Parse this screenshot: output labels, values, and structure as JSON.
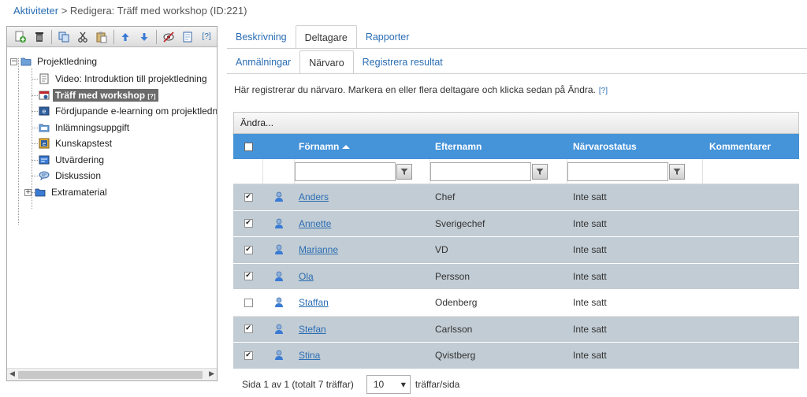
{
  "breadcrumb": {
    "link": "Aktiviteter",
    "separator": ">",
    "current": "Redigera: Träff med workshop (ID:221)"
  },
  "toolbar": {
    "buttons": [
      {
        "icon": "add-icon"
      },
      {
        "icon": "delete-icon"
      },
      {
        "icon": "copy-icon"
      },
      {
        "icon": "cut-icon"
      },
      {
        "icon": "paste-icon"
      },
      {
        "icon": "move-up-icon"
      },
      {
        "icon": "move-down-icon"
      },
      {
        "icon": "hide-icon"
      },
      {
        "icon": "preview-icon"
      },
      {
        "icon": "help-icon",
        "label": "[?]"
      }
    ]
  },
  "tree": {
    "root": {
      "label": "Projektledning",
      "expander": "−",
      "icon": "folder-icon"
    },
    "items": [
      {
        "label": "Video: Introduktion till projektledning",
        "icon": "document-icon"
      },
      {
        "label": "Träff med workshop",
        "badge": "[?]",
        "icon": "meeting-icon",
        "selected": true
      },
      {
        "label": "Fördjupande e-learning om projektledning",
        "icon": "elearning-icon"
      },
      {
        "label": "Inlämningsuppgift",
        "icon": "assignment-icon"
      },
      {
        "label": "Kunskapstest",
        "icon": "test-icon"
      },
      {
        "label": "Utvärdering",
        "icon": "evaluation-icon"
      },
      {
        "label": "Diskussion",
        "icon": "discussion-icon"
      },
      {
        "label": "Extramaterial",
        "icon": "folder-icon",
        "expander": "+"
      }
    ]
  },
  "tabs_main": [
    {
      "label": "Beskrivning",
      "active": false
    },
    {
      "label": "Deltagare",
      "active": true
    },
    {
      "label": "Rapporter",
      "active": false
    }
  ],
  "tabs_sub": [
    {
      "label": "Anmälningar",
      "active": false
    },
    {
      "label": "Närvaro",
      "active": true
    },
    {
      "label": "Registrera resultat",
      "active": false
    }
  ],
  "info": {
    "text": "Här registrerar du närvaro. Markera en eller flera deltagare och klicka sedan på Ändra.",
    "help": "[?]"
  },
  "grid": {
    "toolbar_label": "Ändra...",
    "columns": {
      "first_name": "Förnamn",
      "last_name": "Efternamn",
      "status": "Närvarostatus",
      "comment": "Kommentarer"
    },
    "rows": [
      {
        "checked": true,
        "first": "Anders",
        "last": "Chef",
        "status": "Inte satt",
        "comment": ""
      },
      {
        "checked": true,
        "first": "Annette",
        "last": "Sverigechef",
        "status": "Inte satt",
        "comment": ""
      },
      {
        "checked": true,
        "first": "Marianne",
        "last": "VD",
        "status": "Inte satt",
        "comment": ""
      },
      {
        "checked": true,
        "first": "Ola",
        "last": "Persson",
        "status": "Inte satt",
        "comment": ""
      },
      {
        "checked": false,
        "first": "Staffan",
        "last": "Odenberg",
        "status": "Inte satt",
        "comment": ""
      },
      {
        "checked": true,
        "first": "Stefan",
        "last": "Carlsson",
        "status": "Inte satt",
        "comment": ""
      },
      {
        "checked": true,
        "first": "Stina",
        "last": "Qvistberg",
        "status": "Inte satt",
        "comment": ""
      }
    ]
  },
  "pager": {
    "summary": "Sida 1 av 1 (totalt 7 träffar)",
    "page_size": "10",
    "page_size_label": "träffar/sida"
  },
  "colors": {
    "link": "#2a6db3",
    "header_bg": "#4593d9",
    "selected_row": "#c2ccd4",
    "tree_selected": "#6b6b6b"
  }
}
